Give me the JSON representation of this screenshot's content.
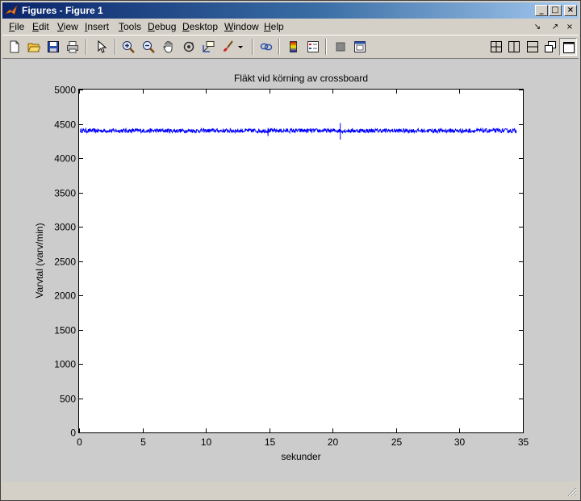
{
  "window": {
    "title": "Figures - Figure 1",
    "controls": {
      "minimize": "_",
      "maximize": "□",
      "close": "×"
    }
  },
  "menubar": {
    "items": [
      {
        "label": "File",
        "underline": "F",
        "rest": "ile"
      },
      {
        "label": "Edit",
        "underline": "E",
        "rest": "dit"
      },
      {
        "label": "View",
        "underline": "V",
        "rest": "iew"
      },
      {
        "label": "Insert",
        "underline": "I",
        "rest": "nsert"
      },
      {
        "label": "Tools",
        "underline": "T",
        "rest": "ools"
      },
      {
        "label": "Debug",
        "underline": "D",
        "rest": "ebug"
      },
      {
        "label": "Desktop",
        "underline": "D",
        "rest": "esktop"
      },
      {
        "label": "Window",
        "underline": "W",
        "rest": "indow"
      },
      {
        "label": "Help",
        "underline": "H",
        "rest": "elp"
      }
    ],
    "dock_controls": [
      "↘",
      "↗",
      "×"
    ]
  },
  "toolbar": {
    "buttons": [
      "new-figure-icon",
      "open-file-icon",
      "save-icon",
      "print-icon",
      "pointer-icon",
      "zoom-in-icon",
      "zoom-out-icon",
      "pan-hand-icon",
      "rotate-3d-icon",
      "data-cursor-icon",
      "brush-icon",
      "brush-dropdown-icon",
      "link-plot-icon",
      "colorbar-icon",
      "legend-icon",
      "hide-plot-tools-icon",
      "show-plot-tools-icon"
    ],
    "layout_buttons": [
      "tile-grid-icon",
      "split-columns-icon",
      "split-rows-icon",
      "float-icon",
      "maximize-figure-icon"
    ]
  },
  "colors": {
    "line": "#0000ff",
    "figure_bg": "#cccccc",
    "axes_bg": "#ffffff",
    "title_active": "#0a246a"
  },
  "chart_data": {
    "type": "line",
    "title": "Fläkt vid körning av crossboard",
    "xlabel": "sekunder",
    "ylabel": "Varvtal (varv/min)",
    "xlim": [
      0,
      35
    ],
    "ylim": [
      0,
      5000
    ],
    "xticks": [
      0,
      5,
      10,
      15,
      20,
      25,
      30,
      35
    ],
    "yticks": [
      0,
      500,
      1000,
      1500,
      2000,
      2500,
      3000,
      3500,
      4000,
      4500,
      5000
    ],
    "grid": false,
    "series": [
      {
        "x_start": 0.1,
        "x_end": 34.5,
        "mean": 4400,
        "noise_band": [
          4350,
          4460
        ],
        "spikes": [
          {
            "x": 14.9,
            "min": 4320,
            "max": 4440
          },
          {
            "x": 20.6,
            "min": 4270,
            "max": 4510
          }
        ]
      }
    ]
  }
}
